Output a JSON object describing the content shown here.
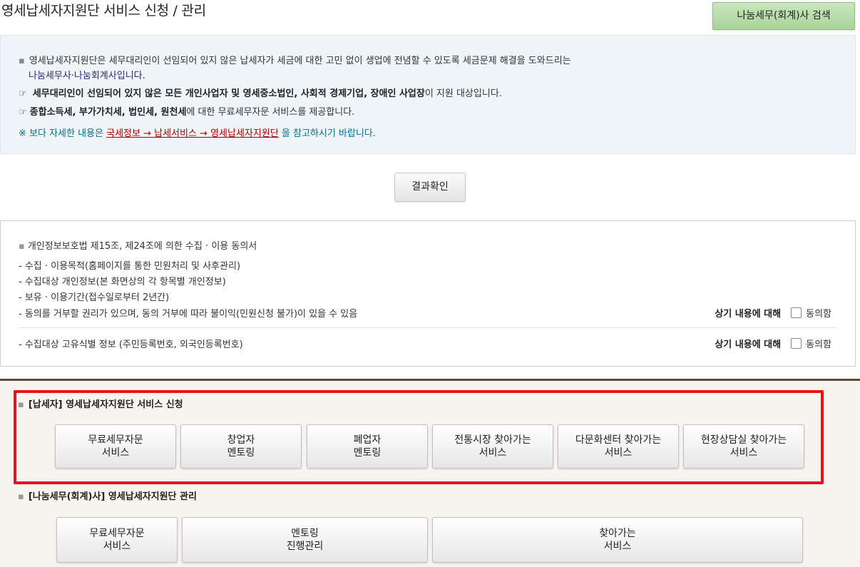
{
  "header": {
    "title": "영세납세자지원단 서비스 신청 / 관리",
    "search_button": "나눔세무(회계)사 검색"
  },
  "info": {
    "line1": "영세납세자지원단은 세무대리인이 선임되어 있지 않은 납세자가 세금에 대한 고민 없이 생업에 전념할 수 있도록 세금문제 해결을 도와드리는",
    "line2": "나눔세무사·나눔회계사입니다.",
    "line3_bold_a": "세무대리인이 선임되어 있지 않은 모든 개인사업자 및 영세중소법인, 사회적 경제기업, 장애인 사업장",
    "line3_rest": "이 지원 대상입니다.",
    "line4_bold": "종합소득세, 부가가치세, 법인세, 원천세",
    "line4_rest": "에 대한 무료세무자문 서비스를 제공합니다.",
    "line5_prefix": "※ 보다 자세한 내용은",
    "line5_link": "국세정보 → 납세서비스 → 영세납세자지원단",
    "line5_suffix": "을 참고하시기 바랍니다."
  },
  "result_button": "결과확인",
  "consent": {
    "heading": "개인정보보호법 제15조,  제24조에 의한 수집 · 이용 동의서",
    "items": [
      "- 수집 · 이용목적(홈페이지를 통한 민원처리 및 사후관리)",
      "- 수집대상 개인정보(본 화면상의 각 항목별 개인정보)",
      "- 보유 · 이용기간(접수일로부터 2년간)",
      "- 동의를 거부할 권리가 있으며, 동의 거부에 따라 불이익(민원신청 불가)이 있을 수 있음"
    ],
    "unique_id_item": "-  수집대상 고유식별 정보 (주민등록번호, 외국인등록번호)",
    "agree_label": "상기 내용에 대해",
    "agree_check_label": "동의함"
  },
  "taxpayer_section": {
    "title": "[납세자] 영세납세자지원단 서비스 신청",
    "buttons": [
      [
        "무료세무자문",
        "서비스"
      ],
      [
        "창업자",
        "멘토링"
      ],
      [
        "폐업자",
        "멘토링"
      ],
      [
        "전통시장 찾아가는",
        "서비스"
      ],
      [
        "다문화센터 찾아가는",
        "서비스"
      ],
      [
        "현장상담실 찾아가는",
        "서비스"
      ]
    ]
  },
  "advisor_section": {
    "title": "[나눔세무(회계)사] 영세납세자지원단 관리",
    "buttons": [
      [
        "무료세무자문",
        "서비스"
      ],
      [
        "멘토링",
        "진행관리"
      ],
      [
        "찾아가는",
        "서비스"
      ]
    ]
  },
  "colors": {
    "highlight": "#e4141c",
    "search_button_bg": "#b7dca8",
    "link": "#b00000",
    "info_bg": "#eff4f9"
  }
}
